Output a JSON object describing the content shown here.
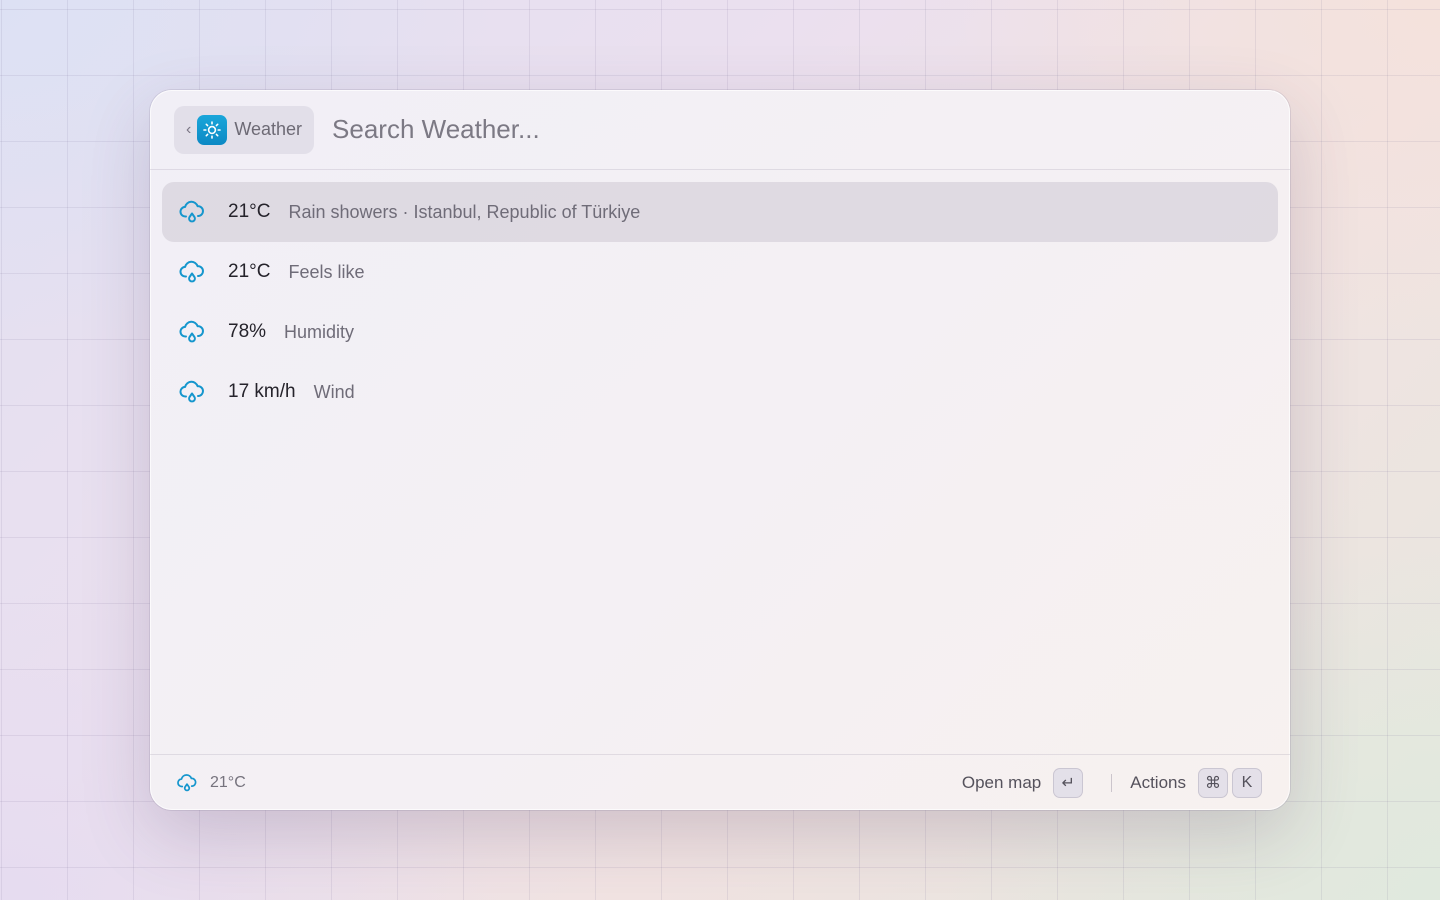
{
  "header": {
    "back_icon": "chevron-left-icon",
    "app_name": "Weather",
    "app_icon": "sun-icon",
    "search_placeholder": "Search Weather..."
  },
  "colors": {
    "accent": "#1596cd",
    "icon_tile": "#0c89c4"
  },
  "results": [
    {
      "icon": "cloud-rain-icon",
      "value": "21°C",
      "label": "Rain showers · Istanbul, Republic of Türkiye",
      "selected": true
    },
    {
      "icon": "cloud-rain-icon",
      "value": "21°C",
      "label": "Feels like",
      "selected": false
    },
    {
      "icon": "cloud-rain-icon",
      "value": "78%",
      "label": "Humidity",
      "selected": false
    },
    {
      "icon": "cloud-rain-icon",
      "value": "17 km/h",
      "label": "Wind",
      "selected": false
    }
  ],
  "footer": {
    "status_icon": "cloud-rain-icon",
    "status_text": "21°C",
    "primary_action": "Open map",
    "primary_key": "↵",
    "secondary_action": "Actions",
    "secondary_keys": [
      "⌘",
      "K"
    ]
  }
}
